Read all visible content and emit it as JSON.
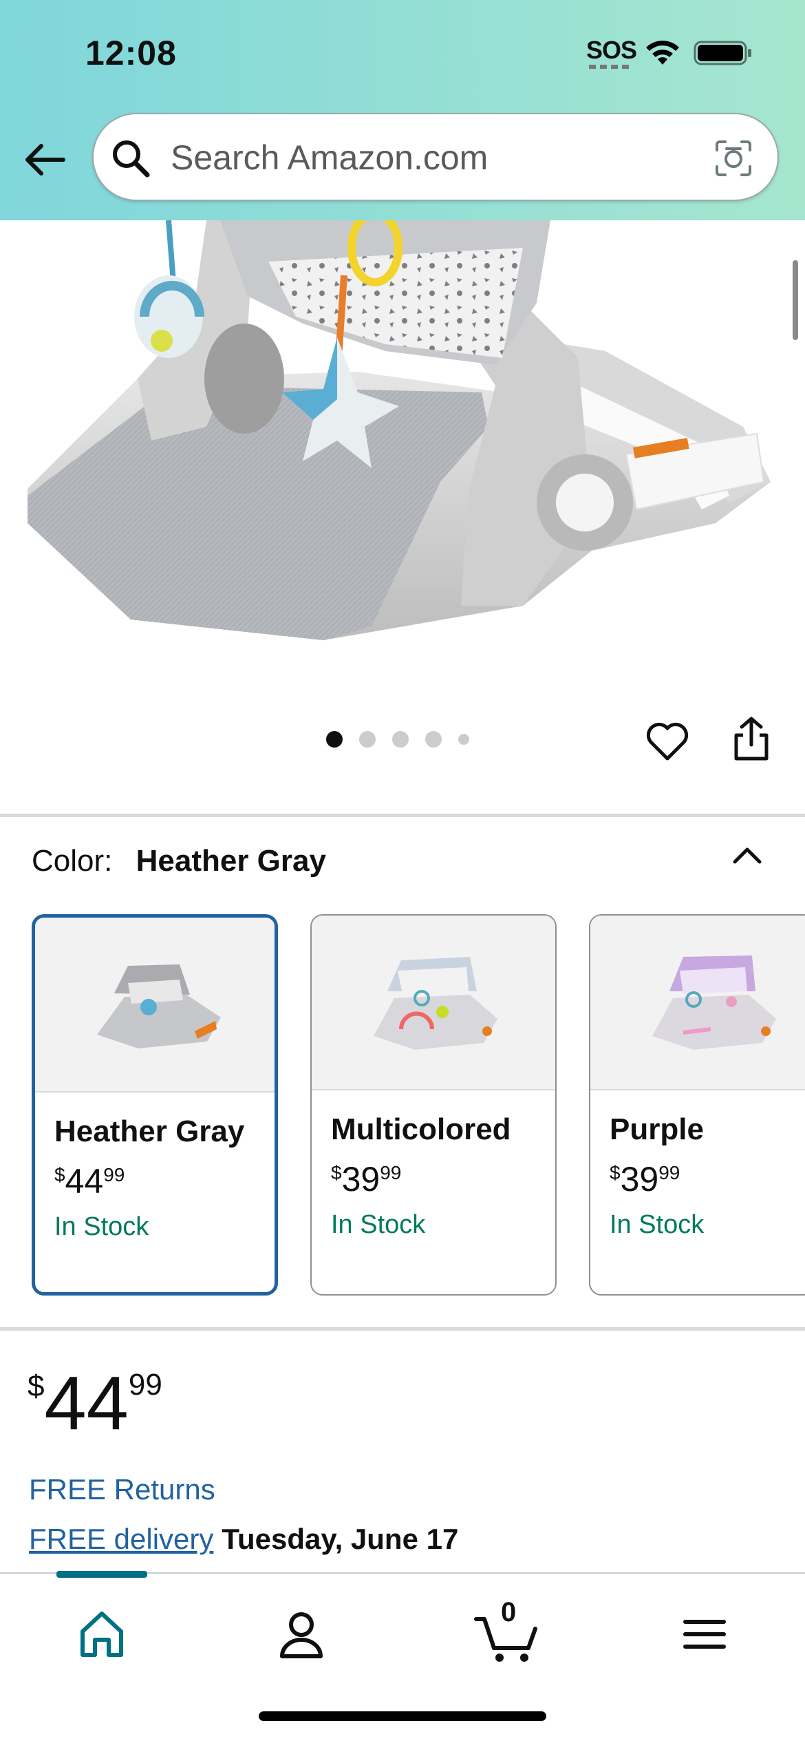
{
  "status_bar": {
    "time": "12:08",
    "sos": "SOS"
  },
  "search": {
    "placeholder": "Search Amazon.com"
  },
  "gallery": {
    "image_count": 5,
    "active_index": 0
  },
  "color": {
    "label": "Color:",
    "selected": "Heather Gray",
    "options": [
      {
        "name": "Heather Gray",
        "price_symbol": "$",
        "price_whole": "44",
        "price_cents": "99",
        "stock": "In Stock",
        "selected": true
      },
      {
        "name": "Multicolored",
        "price_symbol": "$",
        "price_whole": "39",
        "price_cents": "99",
        "stock": "In Stock",
        "selected": false
      },
      {
        "name": "Purple",
        "price_symbol": "$",
        "price_whole": "39",
        "price_cents": "99",
        "stock": "In Stock",
        "selected": false
      }
    ]
  },
  "price": {
    "symbol": "$",
    "whole": "44",
    "cents": "99"
  },
  "shipping": {
    "returns": "FREE Returns",
    "delivery_link": "FREE delivery",
    "delivery_date": "Tuesday, June 17"
  },
  "bottom_nav": {
    "cart_count": "0",
    "active": "home"
  },
  "colors": {
    "link": "#2162a1",
    "stock": "#007a5a",
    "nav_active": "#007185",
    "selected_border": "#2162a1"
  }
}
